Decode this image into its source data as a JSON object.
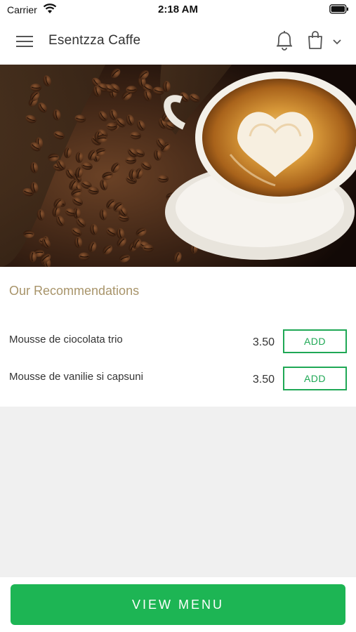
{
  "status_bar": {
    "carrier": "Carrier",
    "time": "2:18 AM"
  },
  "header": {
    "title": "Esentzza Caffe",
    "icons": [
      "hamburger-menu-icon",
      "bell-icon",
      "shopping-bag-icon",
      "chevron-down-icon"
    ]
  },
  "hero": {
    "image": "coffee-cup-latte-art-with-coffee-beans"
  },
  "recommendations": {
    "title": "Our Recommendations",
    "items": [
      {
        "name": "Mousse de ciocolata trio",
        "price": "3.50",
        "button": "ADD"
      },
      {
        "name": "Mousse de vanilie si capsuni",
        "price": "3.50",
        "button": "ADD"
      }
    ]
  },
  "footer": {
    "view_menu_label": "VIEW MENU"
  },
  "colors": {
    "accent_green": "#1db554",
    "section_title": "#a8946a",
    "background": "#f0f0f0"
  }
}
